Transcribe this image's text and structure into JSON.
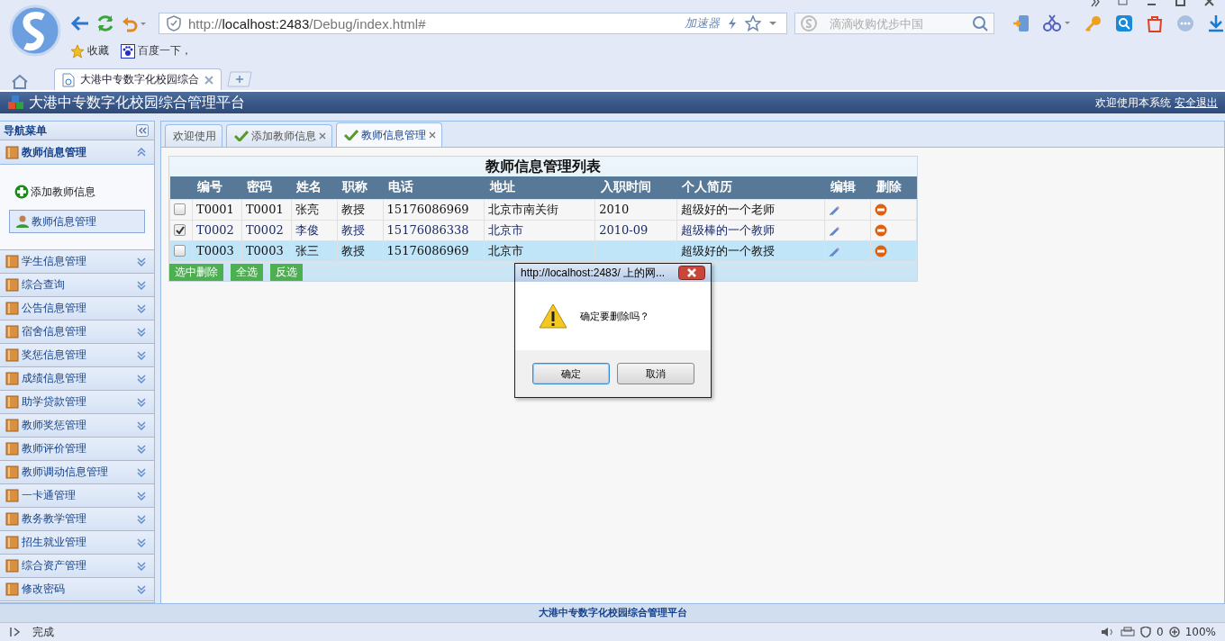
{
  "browser": {
    "address": {
      "scheme": "http://",
      "host": "localhost:2483",
      "path": "/Debug/index.html#"
    },
    "accelerator": "加速器",
    "search": {
      "placeholder": "滴滴收购优步中国"
    },
    "bookmarks": [
      "收藏",
      "百度一下，"
    ],
    "tabs": [
      {
        "title": "大港中专数字化校园综合",
        "selected": true
      }
    ]
  },
  "app": {
    "title": "大港中专数字化校园综合管理平台",
    "welcome": "欢迎使用本系统",
    "logout": "安全退出"
  },
  "sidebar": {
    "title": "导航菜单",
    "sections": [
      {
        "label": "教师信息管理",
        "expanded": true,
        "children": [
          {
            "label": "添加教师信息",
            "kind": "add",
            "selected": false
          },
          {
            "label": "教师信息管理",
            "kind": "user",
            "selected": true
          }
        ]
      },
      {
        "label": "学生信息管理",
        "expanded": false
      },
      {
        "label": "综合查询",
        "expanded": false
      },
      {
        "label": "公告信息管理",
        "expanded": false
      },
      {
        "label": "宿舍信息管理",
        "expanded": false
      },
      {
        "label": "奖惩信息管理",
        "expanded": false
      },
      {
        "label": "成绩信息管理",
        "expanded": false
      },
      {
        "label": "助学贷款管理",
        "expanded": false
      },
      {
        "label": "教师奖惩管理",
        "expanded": false
      },
      {
        "label": "教师评价管理",
        "expanded": false
      },
      {
        "label": "教师调动信息管理",
        "expanded": false
      },
      {
        "label": "一卡通管理",
        "expanded": false
      },
      {
        "label": "教务教学管理",
        "expanded": false
      },
      {
        "label": "招生就业管理",
        "expanded": false
      },
      {
        "label": "综合资产管理",
        "expanded": false
      },
      {
        "label": "修改密码",
        "expanded": false
      }
    ]
  },
  "tabs": [
    {
      "label": "欢迎使用",
      "selected": false,
      "closable": false
    },
    {
      "label": "添加教师信息",
      "selected": false,
      "closable": true
    },
    {
      "label": "教师信息管理",
      "selected": true,
      "closable": true
    }
  ],
  "table": {
    "title": "教师信息管理列表",
    "columns": [
      "编号",
      "密码",
      "姓名",
      "职称",
      "电话",
      "地址",
      "入职时间",
      "个人简历",
      "编辑",
      "删除"
    ],
    "rows": [
      {
        "checked": false,
        "selected": false,
        "cells": [
          "T0001",
          "T0001",
          "张亮",
          "教授",
          "15176086969",
          "北京市南关街",
          "2010",
          "超级好的一个老师"
        ]
      },
      {
        "checked": true,
        "selected": false,
        "cells": [
          "T0002",
          "T0002",
          "李俊",
          "教授",
          "15176086338",
          "北京市",
          "2010-09",
          "超级棒的一个教师"
        ]
      },
      {
        "checked": false,
        "selected": true,
        "cells": [
          "T0003",
          "T0003",
          "张三",
          "教授",
          "15176086969",
          "北京市",
          null,
          "超级好的一个教授"
        ]
      }
    ],
    "buttons": [
      "选中删除",
      "全选",
      "反选"
    ]
  },
  "dialog": {
    "title": "http://localhost:2483/ 上的网...",
    "message": "确定要删除吗？",
    "buttons": [
      {
        "label": "确定",
        "default": true
      },
      {
        "label": "取消",
        "default": false
      }
    ]
  },
  "footer": "大港中专数字化校园综合管理平台",
  "status": {
    "text": "完成",
    "count": "0",
    "zoom": "100%"
  }
}
